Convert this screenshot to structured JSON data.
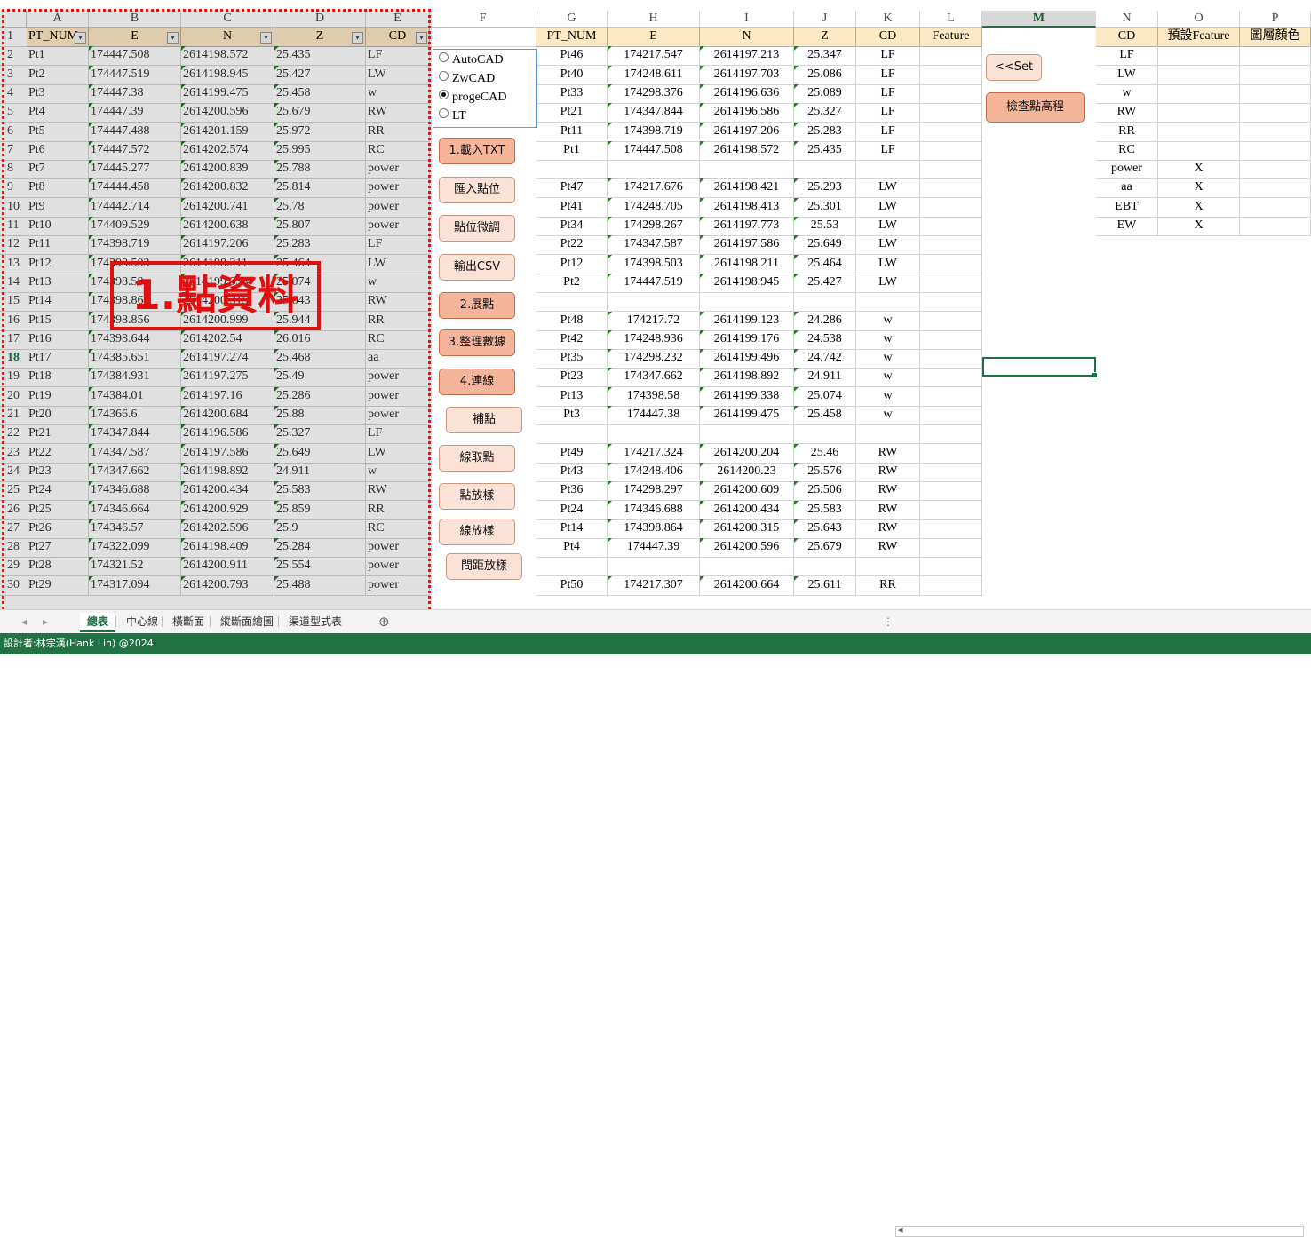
{
  "columns": [
    "A",
    "B",
    "C",
    "D",
    "E",
    "F",
    "G",
    "H",
    "I",
    "J",
    "K",
    "L",
    "M",
    "N",
    "O",
    "P"
  ],
  "selected_column": "M",
  "selected_row": "18",
  "left_table": {
    "headers": [
      "PT_NUM",
      "E",
      "N",
      "Z",
      "CD"
    ],
    "rows": [
      [
        "Pt1",
        "174447.508",
        "2614198.572",
        "25.435",
        "LF"
      ],
      [
        "Pt2",
        "174447.519",
        "2614198.945",
        "25.427",
        "LW"
      ],
      [
        "Pt3",
        "174447.38",
        "2614199.475",
        "25.458",
        "w"
      ],
      [
        "Pt4",
        "174447.39",
        "2614200.596",
        "25.679",
        "RW"
      ],
      [
        "Pt5",
        "174447.488",
        "2614201.159",
        "25.972",
        "RR"
      ],
      [
        "Pt6",
        "174447.572",
        "2614202.574",
        "25.995",
        "RC"
      ],
      [
        "Pt7",
        "174445.277",
        "2614200.839",
        "25.788",
        "power"
      ],
      [
        "Pt8",
        "174444.458",
        "2614200.832",
        "25.814",
        "power"
      ],
      [
        "Pt9",
        "174442.714",
        "2614200.741",
        "25.78",
        "power"
      ],
      [
        "Pt10",
        "174409.529",
        "2614200.638",
        "25.807",
        "power"
      ],
      [
        "Pt11",
        "174398.719",
        "2614197.206",
        "25.283",
        "LF"
      ],
      [
        "Pt12",
        "174398.503",
        "2614198.211",
        "25.464",
        "LW"
      ],
      [
        "Pt13",
        "174398.58",
        "2614199.338",
        "25.074",
        "w"
      ],
      [
        "Pt14",
        "174398.864",
        "2614200.315",
        "25.643",
        "RW"
      ],
      [
        "Pt15",
        "174398.856",
        "2614200.999",
        "25.944",
        "RR"
      ],
      [
        "Pt16",
        "174398.644",
        "2614202.54",
        "26.016",
        "RC"
      ],
      [
        "Pt17",
        "174385.651",
        "2614197.274",
        "25.468",
        "aa"
      ],
      [
        "Pt18",
        "174384.931",
        "2614197.275",
        "25.49",
        "power"
      ],
      [
        "Pt19",
        "174384.01",
        "2614197.16",
        "25.286",
        "power"
      ],
      [
        "Pt20",
        "174366.6",
        "2614200.684",
        "25.88",
        "power"
      ],
      [
        "Pt21",
        "174347.844",
        "2614196.586",
        "25.327",
        "LF"
      ],
      [
        "Pt22",
        "174347.587",
        "2614197.586",
        "25.649",
        "LW"
      ],
      [
        "Pt23",
        "174347.662",
        "2614198.892",
        "24.911",
        "w"
      ],
      [
        "Pt24",
        "174346.688",
        "2614200.434",
        "25.583",
        "RW"
      ],
      [
        "Pt25",
        "174346.664",
        "2614200.929",
        "25.859",
        "RR"
      ],
      [
        "Pt26",
        "174346.57",
        "2614202.596",
        "25.9",
        "RC"
      ],
      [
        "Pt27",
        "174322.099",
        "2614198.409",
        "25.284",
        "power"
      ],
      [
        "Pt28",
        "174321.52",
        "2614200.911",
        "25.554",
        "power"
      ],
      [
        "Pt29",
        "174317.094",
        "2614200.793",
        "25.488",
        "power"
      ]
    ]
  },
  "overlay_label": "1.點資料",
  "cad_options": [
    {
      "label": "AutoCAD",
      "selected": false
    },
    {
      "label": "ZwCAD",
      "selected": false
    },
    {
      "label": "progeCAD",
      "selected": true
    },
    {
      "label": "LT",
      "selected": false
    }
  ],
  "macro_buttons": [
    {
      "label": "1.載入TXT",
      "style": "dark"
    },
    {
      "label": "匯入點位",
      "style": "light"
    },
    {
      "label": "點位微調",
      "style": "light"
    },
    {
      "label": "輸出CSV",
      "style": "light"
    },
    {
      "label": "2.展點",
      "style": "dark"
    },
    {
      "label": "3.整理數據",
      "style": "dark"
    },
    {
      "label": "4.連線",
      "style": "dark"
    },
    {
      "label": "補點",
      "style": "light"
    },
    {
      "label": "線取點",
      "style": "light"
    },
    {
      "label": "點放樣",
      "style": "light"
    },
    {
      "label": "線放樣",
      "style": "light"
    },
    {
      "label": "間距放樣",
      "style": "light"
    }
  ],
  "right_table": {
    "headers": [
      "PT_NUM",
      "E",
      "N",
      "Z",
      "CD",
      "Feature"
    ],
    "rows": [
      [
        "Pt46",
        "174217.547",
        "2614197.213",
        "25.347",
        "LF"
      ],
      [
        "Pt40",
        "174248.611",
        "2614197.703",
        "25.086",
        "LF"
      ],
      [
        "Pt33",
        "174298.376",
        "2614196.636",
        "25.089",
        "LF"
      ],
      [
        "Pt21",
        "174347.844",
        "2614196.586",
        "25.327",
        "LF"
      ],
      [
        "Pt11",
        "174398.719",
        "2614197.206",
        "25.283",
        "LF"
      ],
      [
        "Pt1",
        "174447.508",
        "2614198.572",
        "25.435",
        "LF"
      ],
      [
        "",
        "",
        "",
        "",
        ""
      ],
      [
        "Pt47",
        "174217.676",
        "2614198.421",
        "25.293",
        "LW"
      ],
      [
        "Pt41",
        "174248.705",
        "2614198.413",
        "25.301",
        "LW"
      ],
      [
        "Pt34",
        "174298.267",
        "2614197.773",
        "25.53",
        "LW"
      ],
      [
        "Pt22",
        "174347.587",
        "2614197.586",
        "25.649",
        "LW"
      ],
      [
        "Pt12",
        "174398.503",
        "2614198.211",
        "25.464",
        "LW"
      ],
      [
        "Pt2",
        "174447.519",
        "2614198.945",
        "25.427",
        "LW"
      ],
      [
        "",
        "",
        "",
        "",
        ""
      ],
      [
        "Pt48",
        "174217.72",
        "2614199.123",
        "24.286",
        "w"
      ],
      [
        "Pt42",
        "174248.936",
        "2614199.176",
        "24.538",
        "w"
      ],
      [
        "Pt35",
        "174298.232",
        "2614199.496",
        "24.742",
        "w"
      ],
      [
        "Pt23",
        "174347.662",
        "2614198.892",
        "24.911",
        "w"
      ],
      [
        "Pt13",
        "174398.58",
        "2614199.338",
        "25.074",
        "w"
      ],
      [
        "Pt3",
        "174447.38",
        "2614199.475",
        "25.458",
        "w"
      ],
      [
        "",
        "",
        "",
        "",
        ""
      ],
      [
        "Pt49",
        "174217.324",
        "2614200.204",
        "25.46",
        "RW"
      ],
      [
        "Pt43",
        "174248.406",
        "2614200.23",
        "25.576",
        "RW"
      ],
      [
        "Pt36",
        "174298.297",
        "2614200.609",
        "25.506",
        "RW"
      ],
      [
        "Pt24",
        "174346.688",
        "2614200.434",
        "25.583",
        "RW"
      ],
      [
        "Pt14",
        "174398.864",
        "2614200.315",
        "25.643",
        "RW"
      ],
      [
        "Pt4",
        "174447.39",
        "2614200.596",
        "25.679",
        "RW"
      ],
      [
        "",
        "",
        "",
        "",
        ""
      ],
      [
        "Pt50",
        "174217.307",
        "2614200.664",
        "25.611",
        "RR"
      ]
    ]
  },
  "side_buttons": {
    "set": "<<Set",
    "check": "檢查點高程"
  },
  "code_table": {
    "headers": [
      "CD",
      "預設Feature",
      "圖層顏色"
    ],
    "rows": [
      [
        "LF",
        ""
      ],
      [
        "LW",
        ""
      ],
      [
        "w",
        ""
      ],
      [
        "RW",
        ""
      ],
      [
        "RR",
        ""
      ],
      [
        "RC",
        ""
      ],
      [
        "power",
        "X"
      ],
      [
        "aa",
        "X"
      ],
      [
        "EBT",
        "X"
      ],
      [
        "EW",
        "X"
      ]
    ]
  },
  "sheet_tabs": [
    "總表",
    "中心線",
    "橫斷面",
    "縱斷面繪圖",
    "渠道型式表"
  ],
  "active_tab": "總表",
  "status_text": "設計者:林宗漢(Hank Lin) @2024",
  "add_sheet_glyph": "⊕",
  "tab_nav_left": "◂",
  "tab_nav_right": "▸",
  "scroll_dots": "⋮",
  "scroll_left": "◂"
}
